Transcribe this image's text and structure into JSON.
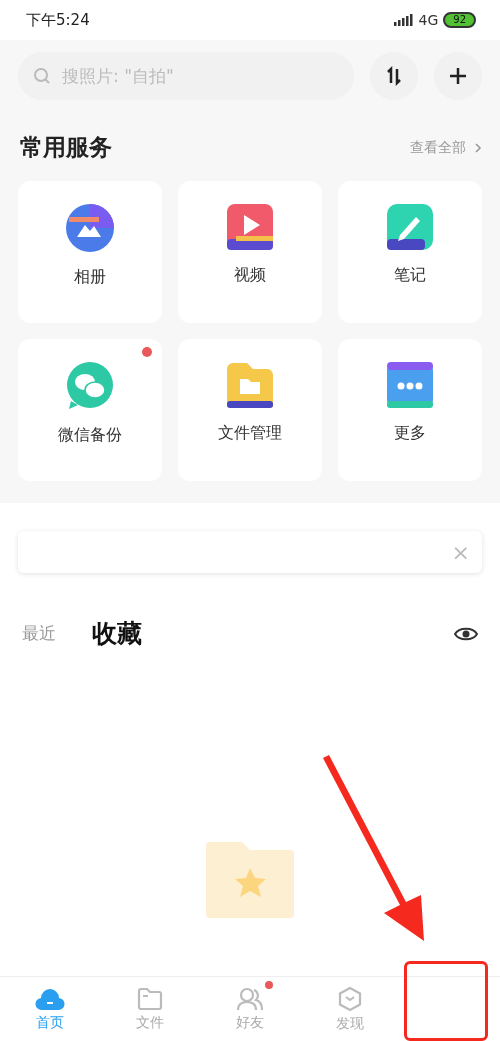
{
  "status_bar": {
    "time": "下午5:24",
    "network": "4G",
    "battery": "92"
  },
  "search": {
    "placeholder": "搜照片: \"自拍\""
  },
  "services": {
    "title": "常用服务",
    "see_all": "查看全部",
    "items": [
      {
        "label": "相册",
        "kind": "album",
        "badge": false
      },
      {
        "label": "视频",
        "kind": "video",
        "badge": false
      },
      {
        "label": "笔记",
        "kind": "note",
        "badge": false
      },
      {
        "label": "微信备份",
        "kind": "chat",
        "badge": true
      },
      {
        "label": "文件管理",
        "kind": "folder",
        "badge": false
      },
      {
        "label": "更多",
        "kind": "more",
        "badge": false
      }
    ]
  },
  "notice": {
    "close": "×"
  },
  "tabs": [
    {
      "label": "最近",
      "selected": false
    },
    {
      "label": "收藏",
      "selected": true
    }
  ],
  "bottom_nav": [
    {
      "label": "首页",
      "kind": "home",
      "selected": true,
      "badge": false
    },
    {
      "label": "文件",
      "kind": "files",
      "selected": false,
      "badge": false
    },
    {
      "label": "好友",
      "kind": "friends",
      "selected": false,
      "badge": true
    },
    {
      "label": "发现",
      "kind": "discover",
      "selected": false,
      "badge": false
    }
  ]
}
